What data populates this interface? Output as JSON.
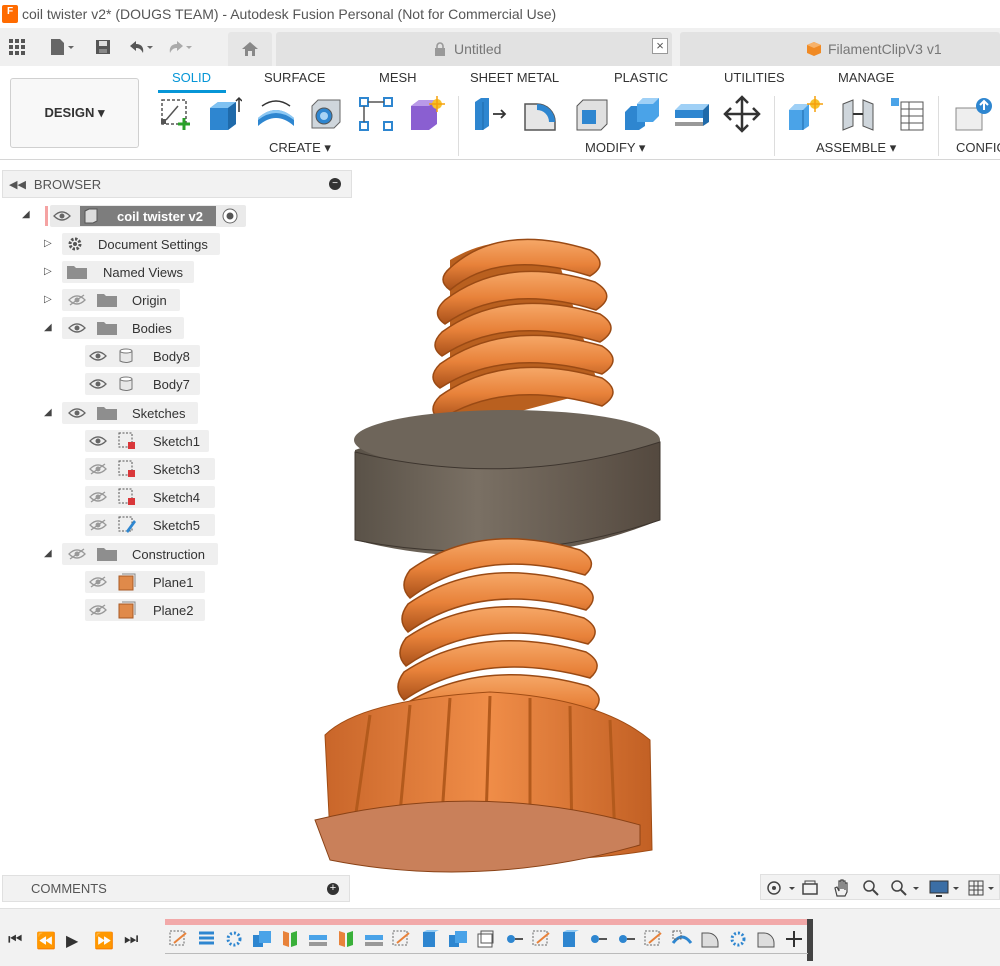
{
  "window": {
    "title": "coil twister v2* (DOUGS TEAM) - Autodesk Fusion Personal (Not for Commercial Use)"
  },
  "document_tabs": [
    {
      "label": "Untitled"
    },
    {
      "label": "FilamentClipV3 v1"
    }
  ],
  "workspace": {
    "label": "DESIGN ▾"
  },
  "ribbon_tabs": [
    {
      "label": "SOLID",
      "active": true
    },
    {
      "label": "SURFACE"
    },
    {
      "label": "MESH"
    },
    {
      "label": "SHEET METAL"
    },
    {
      "label": "PLASTIC"
    },
    {
      "label": "UTILITIES"
    },
    {
      "label": "MANAGE"
    }
  ],
  "tool_groups": {
    "create": "CREATE ▾",
    "modify": "MODIFY ▾",
    "assemble": "ASSEMBLE ▾",
    "configure": "CONFIG"
  },
  "browser": {
    "title": "BROWSER",
    "root": "coil twister v2",
    "items": [
      {
        "label": "Document Settings"
      },
      {
        "label": "Named Views"
      },
      {
        "label": "Origin"
      },
      {
        "label": "Bodies"
      },
      {
        "label": "Body8"
      },
      {
        "label": "Body7"
      },
      {
        "label": "Sketches"
      },
      {
        "label": "Sketch1"
      },
      {
        "label": "Sketch3"
      },
      {
        "label": "Sketch4"
      },
      {
        "label": "Sketch5"
      },
      {
        "label": "Construction"
      },
      {
        "label": "Plane1"
      },
      {
        "label": "Plane2"
      }
    ]
  },
  "comments": {
    "title": "COMMENTS"
  },
  "colors": {
    "accent": "#0696d7",
    "part_orange": "#e8823a",
    "washer_brown": "#6e655a",
    "timeline_red": "#f2a9a9"
  }
}
